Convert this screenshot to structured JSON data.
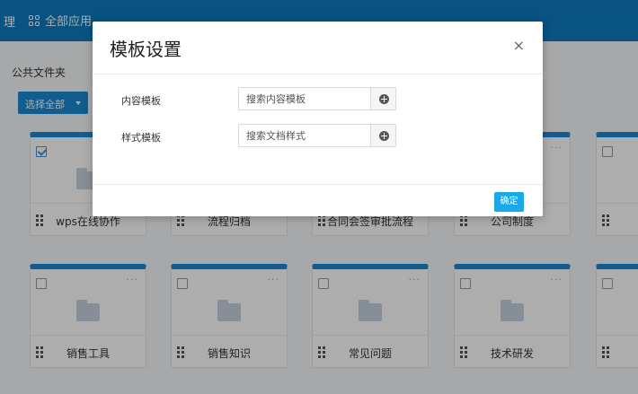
{
  "topbar": {
    "nav_tail": "理",
    "apps_label": "全部应用"
  },
  "content": {
    "folder_title": "公共文件夹",
    "select_all_label": "选择全部",
    "cards": [
      {
        "name": "wps在线协作",
        "checked": true
      },
      {
        "name": "流程归档",
        "checked": false
      },
      {
        "name": "合同会签审批流程",
        "checked": false
      },
      {
        "name": "公司制度",
        "checked": false
      },
      {
        "name": "",
        "checked": false
      },
      {
        "name": "销售工具",
        "checked": false
      },
      {
        "name": "销售知识",
        "checked": false
      },
      {
        "name": "常见问题",
        "checked": false
      },
      {
        "name": "技术研发",
        "checked": false
      },
      {
        "name": "",
        "checked": false
      }
    ],
    "more_glyph": "···"
  },
  "modal": {
    "title": "模板设置",
    "close_glyph": "×",
    "content_template": {
      "label": "内容模板",
      "placeholder": "搜索内容模板",
      "value": ""
    },
    "style_template": {
      "label": "样式模板",
      "placeholder": "搜索文档样式",
      "value": ""
    },
    "confirm_label": "确定"
  },
  "colors": {
    "accent": "#0c7bc0",
    "button": "#1ba8e8",
    "card_top": "#1a8ad3"
  }
}
